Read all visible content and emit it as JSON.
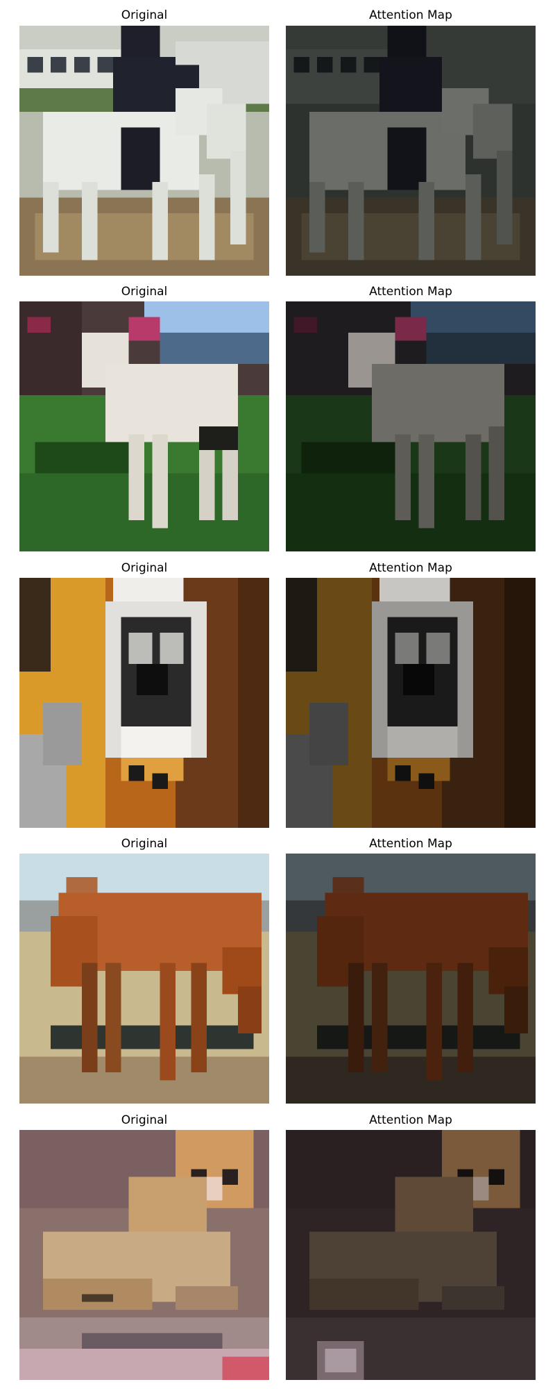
{
  "rows": [
    {
      "original": {
        "title": "Original",
        "image": "pixelated-white-horse-with-rider"
      },
      "attention": {
        "title": "Attention Map",
        "image": "darkened-white-horse-with-rider"
      }
    },
    {
      "original": {
        "title": "Original",
        "image": "pixelated-white-horse-on-grass"
      },
      "attention": {
        "title": "Attention Map",
        "image": "darkened-white-horse-on-grass"
      }
    },
    {
      "original": {
        "title": "Original",
        "image": "pixelated-dog-face-close-up"
      },
      "attention": {
        "title": "Attention Map",
        "image": "darkened-dog-face-close-up"
      }
    },
    {
      "original": {
        "title": "Original",
        "image": "pixelated-brown-horse-grazing"
      },
      "attention": {
        "title": "Attention Map",
        "image": "darkened-brown-horse-grazing"
      }
    },
    {
      "original": {
        "title": "Original",
        "image": "pixelated-cat-lying-down"
      },
      "attention": {
        "title": "Attention Map",
        "image": "darkened-cat-lying-down"
      }
    }
  ]
}
